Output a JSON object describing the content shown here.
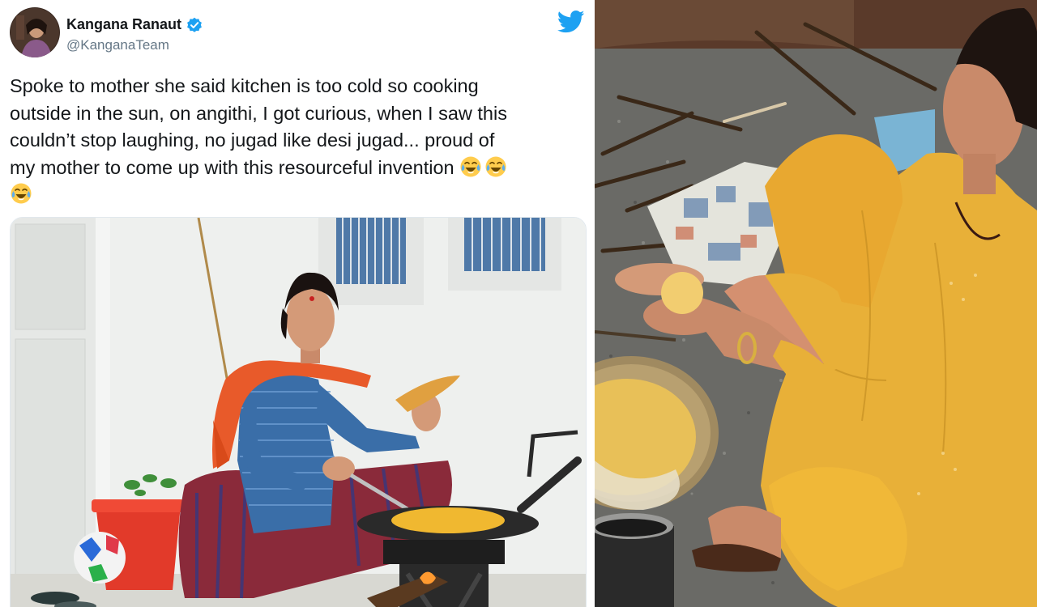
{
  "tweet": {
    "display_name": "Kangana Ranaut",
    "handle": "@KanganaTeam",
    "text_lines": [
      "Spoke to mother she said kitchen is too cold so cooking",
      "outside in the sun, on angithi, I got curious, when I saw this",
      "couldn’t stop laughing, no jugad like desi jugad... proud of",
      "my mother to come up with this resourceful invention"
    ],
    "emoji_name": "face-with-tears-of-joy",
    "verified": true
  },
  "icons": {
    "platform": "twitter-bird-icon",
    "verified": "verified-badge-icon"
  },
  "colors": {
    "twitter_blue": "#1da1f2",
    "text": "#14171a",
    "secondary_text": "#657786"
  }
}
